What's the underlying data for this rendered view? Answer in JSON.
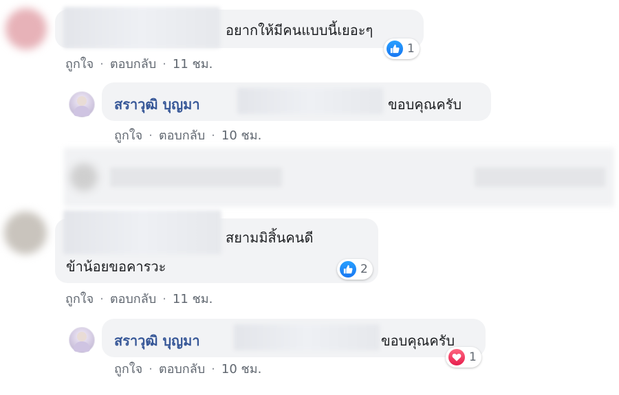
{
  "actions": {
    "like": "ถูกใจ",
    "reply": "ตอบกลับ",
    "separator": "·"
  },
  "comments": [
    {
      "text": "อยากให้มีคนแบบนี้เยอะๆ",
      "time": "11 ชม.",
      "reaction": {
        "icon": "thumbs-up-icon",
        "count": "1",
        "color": "#1877f2"
      },
      "reply": {
        "author": "สราวุฒิ บุญมา",
        "text": "ขอบคุณครับ",
        "time": "10 ชม."
      }
    },
    {
      "text_line1": "สยามมิสิ้นคนดี",
      "text_line2": "ข้าน้อยขอคารวะ",
      "time": "11 ชม.",
      "reaction": {
        "icon": "thumbs-up-icon",
        "count": "2",
        "color": "#1877f2"
      },
      "reply": {
        "author": "สราวุฒิ บุญมา",
        "text": "ขอบคุณครับ",
        "time": "10 ชม.",
        "reaction": {
          "icon": "heart-icon",
          "count": "1",
          "color": "#e61e4d"
        }
      }
    }
  ]
}
